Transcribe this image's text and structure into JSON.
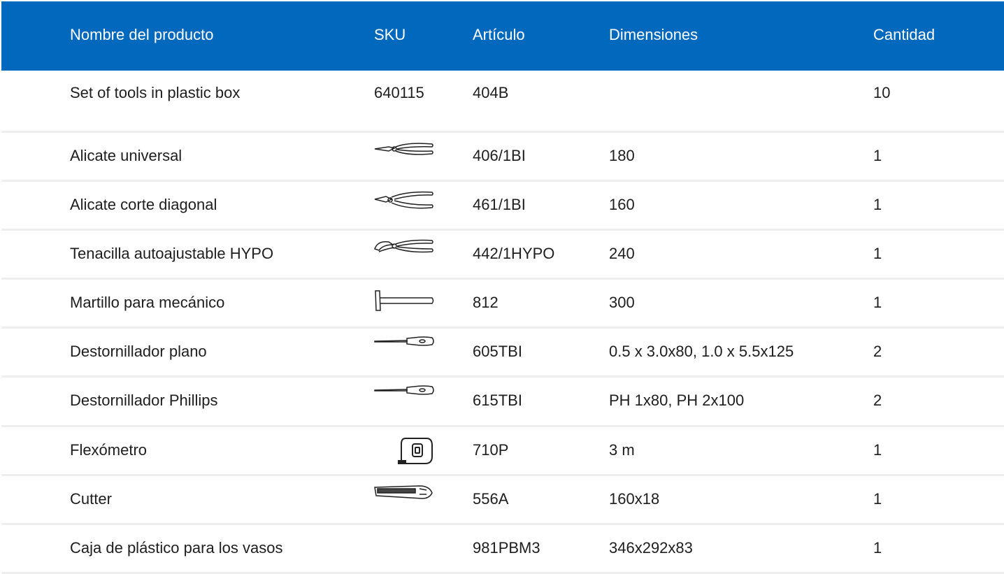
{
  "columns": {
    "name": "Nombre del producto",
    "sku": "SKU",
    "article": "Artículo",
    "dimensions": "Dimensiones",
    "quantity": "Cantidad"
  },
  "rows": [
    {
      "name": "Set of tools in plastic box",
      "sku": "640115",
      "article": "404B",
      "dimensions": "",
      "quantity": "10",
      "icon": ""
    },
    {
      "name": "Alicate universal",
      "sku": "",
      "article": "406/1BI",
      "dimensions": "180",
      "quantity": "1",
      "icon": "combination-pliers-icon"
    },
    {
      "name": "Alicate corte diagonal",
      "sku": "",
      "article": "461/1BI",
      "dimensions": "160",
      "quantity": "1",
      "icon": "diagonal-cutter-icon"
    },
    {
      "name": "Tenacilla autoajustable HYPO",
      "sku": "",
      "article": "442/1HYPO",
      "dimensions": "240",
      "quantity": "1",
      "icon": "adjustable-pliers-icon"
    },
    {
      "name": "Martillo para mecánico",
      "sku": "",
      "article": "812",
      "dimensions": "300",
      "quantity": "1",
      "icon": "hammer-icon"
    },
    {
      "name": "Destornillador plano",
      "sku": "",
      "article": "605TBI",
      "dimensions": "0.5 x 3.0x80, 1.0 x 5.5x125",
      "quantity": "2",
      "icon": "flat-screwdriver-icon"
    },
    {
      "name": "Destornillador Phillips",
      "sku": "",
      "article": "615TBI",
      "dimensions": "PH 1x80, PH 2x100",
      "quantity": "2",
      "icon": "phillips-screwdriver-icon"
    },
    {
      "name": "Flexómetro",
      "sku": "",
      "article": "710P",
      "dimensions": "3 m",
      "quantity": "1",
      "icon": "tape-measure-icon"
    },
    {
      "name": "Cutter",
      "sku": "",
      "article": "556A",
      "dimensions": "160x18",
      "quantity": "1",
      "icon": "cutter-knife-icon"
    },
    {
      "name": "Caja de plástico para los vasos",
      "sku": "",
      "article": "981PBM3",
      "dimensions": "346x292x83",
      "quantity": "1",
      "icon": ""
    }
  ],
  "colors": {
    "header_bg": "#0068bd",
    "header_text": "#ffffff",
    "row_divider": "#eeeeee",
    "body_text": "#1e1e1e"
  }
}
